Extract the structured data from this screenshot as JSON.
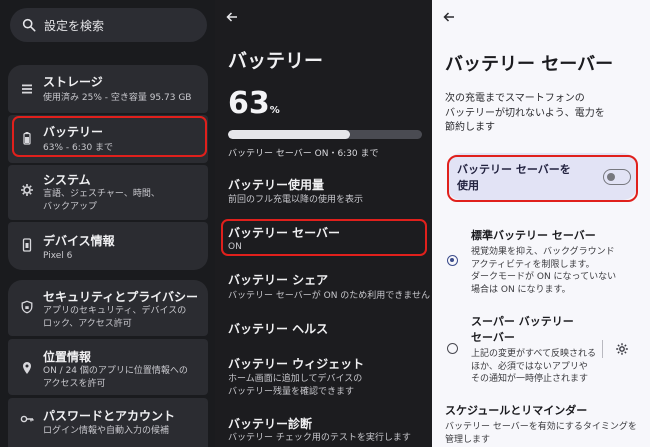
{
  "left": {
    "search_placeholder": "設定を検索",
    "items": [
      {
        "title": "ストレージ",
        "subtitle": "使用済み 25% - 空き容量 95.73 GB",
        "icon": "storage-icon"
      },
      {
        "title": "バッテリー",
        "subtitle": "63% - 6:30 まで",
        "icon": "battery-icon"
      },
      {
        "title": "システム",
        "subtitle": "言語、ジェスチャー、時間、",
        "subtitle2": "バックアップ",
        "icon": "info-icon"
      },
      {
        "title": "デバイス情報",
        "subtitle": "Pixel 6",
        "icon": "phone-icon"
      },
      {
        "title": "セキュリティとプライバシー",
        "subtitle": "アプリのセキュリティ、デバイスの",
        "subtitle2": "ロック、アクセス許可",
        "icon": "shield-icon"
      },
      {
        "title": "位置情報",
        "subtitle": "ON / 24 個のアプリに位置情報への",
        "subtitle2": "アクセスを許可",
        "icon": "location-pin-icon"
      },
      {
        "title": "パスワードとアカウント",
        "subtitle": "ログイン情報や自動入力の候補",
        "icon": "key-icon"
      }
    ]
  },
  "mid": {
    "title": "バッテリー",
    "percent": "63",
    "percent_unit": "%",
    "level": 0.63,
    "status": "バッテリー セーバー ON・6:30 まで",
    "items": [
      {
        "title": "バッテリー使用量",
        "subtitle": "前回のフル充電以降の使用を表示"
      },
      {
        "title": "バッテリー セーバー",
        "subtitle": "ON"
      },
      {
        "title": "バッテリー シェア",
        "subtitle": "バッテリー セーバーが ON のため利用できません"
      },
      {
        "title": "バッテリー ヘルス"
      },
      {
        "title": "バッテリー ウィジェット",
        "subtitle": "ホーム画面に追加してデバイスの",
        "subtitle2": "バッテリー残量を確認できます"
      },
      {
        "title": "バッテリー診断",
        "subtitle": "バッテリー チェック用のテストを実行します"
      }
    ]
  },
  "right": {
    "title": "バッテリー セーバー",
    "description": [
      "次の充電までスマートフォンの",
      "バッテリーが切れないよう、電力を",
      "節約します"
    ],
    "toggle": {
      "label_line1": "バッテリー セーバーを",
      "label_line2": "使用",
      "state": "off"
    },
    "standard": {
      "title": "標準バッテリー セーバー",
      "lines": [
        "視覚効果を抑え、バックグラウンド",
        "アクティビティを制限します。",
        "ダークモードが ON になっていない",
        "場合は ON になります。"
      ]
    },
    "extreme": {
      "title_line1": "スーパー バッテリー",
      "title_line2": "セーバー",
      "lines": [
        "上記の変更がすべて反映される",
        "ほか、必須ではないアプリや",
        "その通知が一時停止されます"
      ]
    },
    "schedule": {
      "title": "スケジュールとリマインダー",
      "subtitle": "バッテリー セーバーを有効にするタイミングを",
      "subtitle2": "管理します"
    }
  }
}
